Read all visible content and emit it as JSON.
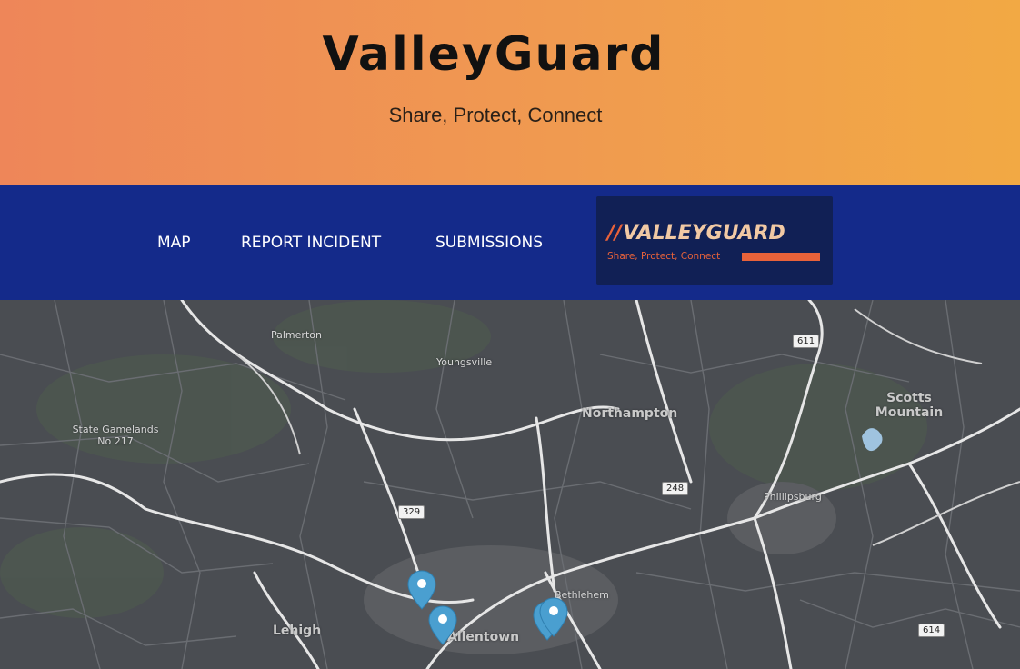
{
  "hero": {
    "title": "ValleyGuard",
    "subtitle": "Share, Protect, Connect"
  },
  "nav": {
    "items": [
      {
        "label": "MAP"
      },
      {
        "label": "REPORT INCIDENT"
      },
      {
        "label": "SUBMISSIONS"
      }
    ]
  },
  "logo": {
    "slashes": "//",
    "wordmark": "VALLEYGUARD",
    "tagline": "Share, Protect, Connect"
  },
  "map": {
    "places": [
      "Palmerton",
      "Youngsville",
      "Northampton",
      "State Gamelands No 217",
      "Scotts Mountain",
      "Phillipsburg",
      "Bethlehem",
      "Allentown",
      "Lehigh"
    ],
    "route_shields": [
      "611",
      "248",
      "329",
      "614"
    ],
    "incident_markers": 4
  },
  "colors": {
    "hero_gradient_start": "#ee8659",
    "hero_gradient_end": "#f2a944",
    "nav_background": "#142a8a",
    "logo_accent": "#e8623a",
    "map_background": "#4a4d52",
    "marker": "#4a9fd0"
  }
}
